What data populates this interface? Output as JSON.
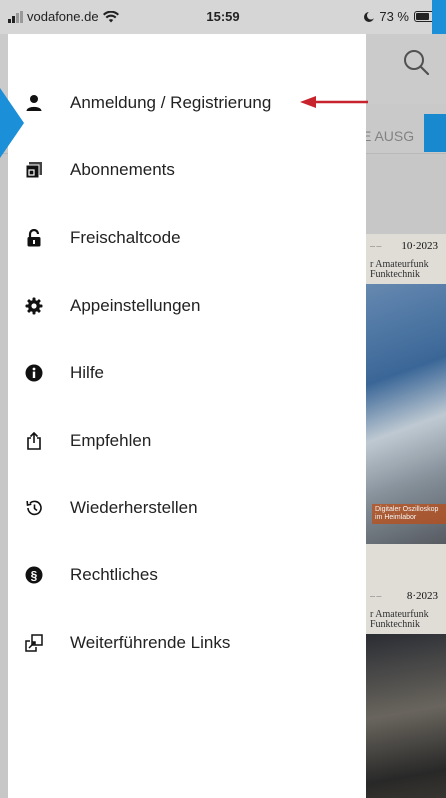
{
  "status_bar": {
    "carrier": "vodafone.de",
    "time": "15:59",
    "battery": "73 %",
    "battery_level": 0.73
  },
  "background_app": {
    "tab_label": "E AUSG",
    "issues": [
      {
        "date": "10·2023",
        "title_line1": "r Amateurfunk",
        "title_line2": "Funktechnik",
        "caption": "Digitaler Oszilloskop im Heimlabor"
      },
      {
        "date": "8·2023",
        "title_line1": "r Amateurfunk",
        "title_line2": "Funktechnik"
      }
    ]
  },
  "menu": {
    "items": [
      {
        "label": "Anmeldung / Registrierung",
        "icon": "user-icon"
      },
      {
        "label": "Abonnements",
        "icon": "subscriptions-icon"
      },
      {
        "label": "Freischaltcode",
        "icon": "lock-icon"
      },
      {
        "label": "Appeinstellungen",
        "icon": "gear-icon"
      },
      {
        "label": "Hilfe",
        "icon": "info-icon"
      },
      {
        "label": "Empfehlen",
        "icon": "share-icon"
      },
      {
        "label": "Wiederherstellen",
        "icon": "restore-icon"
      },
      {
        "label": "Rechtliches",
        "icon": "section-icon"
      },
      {
        "label": "Weiterführende Links",
        "icon": "external-links-icon"
      }
    ]
  },
  "colors": {
    "accent_blue": "#1b8fd8",
    "arrow_red": "#c8232c",
    "drawer_bg": "#ffffff"
  }
}
